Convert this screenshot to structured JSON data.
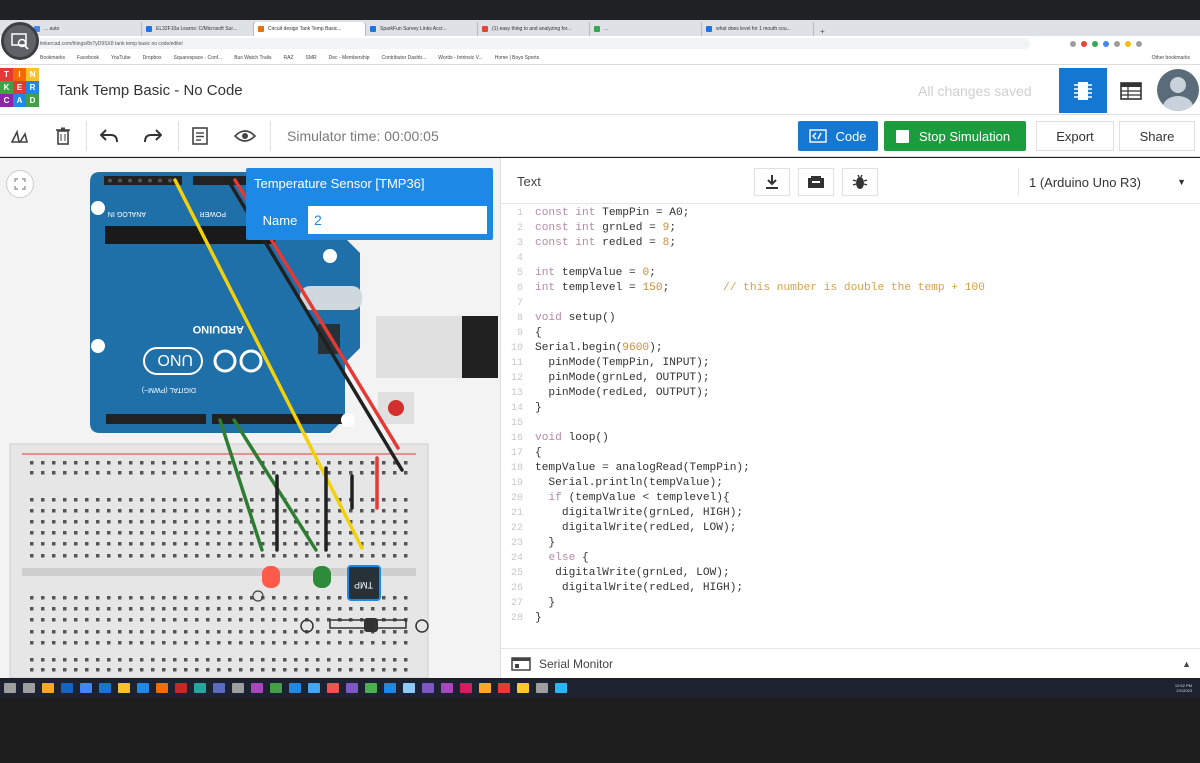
{
  "browser": {
    "tabs": [
      {
        "label": "... auto",
        "color": "#4285f4",
        "active": false
      },
      {
        "label": "EL32F10a Learns: C/Microsoft Sur...",
        "color": "#1a73e8",
        "active": false
      },
      {
        "label": "Circuit design Tank Temp Basic...",
        "color": "#e8710a",
        "active": true
      },
      {
        "label": "SparkFun Survey Links Accr...",
        "color": "#1a73e8",
        "active": false
      },
      {
        "label": "(1) easy thing to and analyzing for...",
        "color": "#ea4335",
        "active": false
      },
      {
        "label": "...",
        "color": "#34a853",
        "active": false
      },
      {
        "label": "what does level for 1 mouth cou...",
        "color": "#1a73e8",
        "active": false
      }
    ],
    "new_tab": "+",
    "url": "tinkercad.com/things/8xTyD9SX8 tank temp basic no code/editel",
    "bookmarks": [
      "Bookmarks",
      "Facebook",
      "YouTube",
      "Dropbox",
      "Squarespace - Conf...",
      "Bus Watch Trails",
      "RAZ",
      "SMR",
      "Dec - Membership",
      "Contributor Dashb...",
      "Words - Intrinsic V...",
      "Home | Boys Sports"
    ],
    "other_bookmarks": "Other bookmarks"
  },
  "tinkercad": {
    "logo_letters": [
      "T",
      "I",
      "N",
      "K",
      "E",
      "R",
      "C",
      "A",
      "D"
    ],
    "logo_colors": [
      "#e53935",
      "#ef6c00",
      "#fbc02d",
      "#43a047",
      "#e53935",
      "#1e88e5",
      "#8e24aa",
      "#1e88e5",
      "#43a047"
    ],
    "project_title": "Tank Temp Basic - No Code",
    "save_status": "All changes saved"
  },
  "toolbar": {
    "sim_time": "Simulator time: 00:00:05",
    "code_label": "Code",
    "stop_label": "Stop Simulation",
    "export_label": "Export",
    "share_label": "Share"
  },
  "inspector": {
    "title": "Temperature Sensor [TMP36]",
    "name_label": "Name",
    "name_value": "2"
  },
  "board": {
    "left_label": "ANALOG IN",
    "power_label": "POWER",
    "brand": "ARDUINO",
    "model": "UNO",
    "digital_label": "DIGITAL (PWM~)",
    "sensor_label": "TMP"
  },
  "code_panel": {
    "mode": "Text",
    "board_select": "1 (Arduino Uno R3)",
    "lines": [
      "const int TempPin = A0;",
      "const int grnLed = 9;",
      "const int redLed = 8;",
      "",
      "int tempValue = 0;",
      "int templevel = 150;        // this number is double the temp + 100",
      "",
      "void setup()",
      "{",
      "Serial.begin(9600);",
      "  pinMode(TempPin, INPUT);",
      "  pinMode(grnLed, OUTPUT);",
      "  pinMode(redLed, OUTPUT);",
      "}",
      "",
      "void loop()",
      "{",
      "tempValue = analogRead(TempPin);",
      "  Serial.println(tempValue);",
      "  if (tempValue < templevel){",
      "    digitalWrite(grnLed, HIGH);",
      "    digitalWrite(redLed, LOW);",
      "  }",
      "  else {",
      "   digitalWrite(grnLed, LOW);",
      "    digitalWrite(redLed, HIGH);",
      "  }",
      "}"
    ],
    "serial_monitor": "Serial Monitor"
  },
  "taskbar": {
    "time": "12:52 PM",
    "date": "2/1/2023",
    "icons": [
      "#9e9e9e",
      "#9e9e9e",
      "#f9a825",
      "#1565c0",
      "#4285f4",
      "#1976d2",
      "#fbc02d",
      "#1e88e5",
      "#ef6c00",
      "#c62828",
      "#26a69a",
      "#5c6bc0",
      "#9e9e9e",
      "#ab47bc",
      "#43a047",
      "#1e88e5",
      "#42a5f5",
      "#ef5350",
      "#7e57c2",
      "#4caf50",
      "#1e88e5",
      "#90caf9",
      "#7e57c2",
      "#ab47bc",
      "#d81b60",
      "#ffa726",
      "#e53935",
      "#ffca28",
      "#9e9e9e",
      "#29b6f6"
    ]
  },
  "colors": {
    "accent": "#1477d1",
    "stop_green": "#1b9d3e",
    "keyword": "#b78aa0",
    "number": "#d08c3c",
    "comment": "#d9a04a"
  }
}
